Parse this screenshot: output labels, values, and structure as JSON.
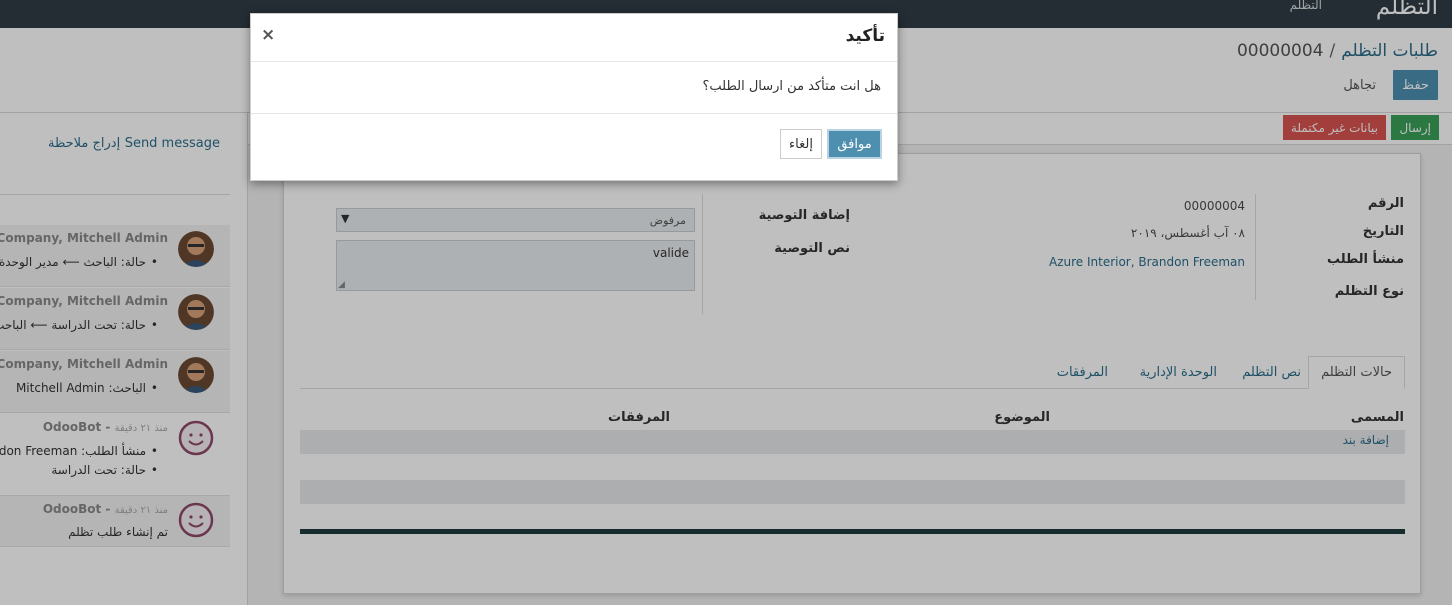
{
  "navbar": {
    "brand": "التظلم",
    "menu": "التظلم"
  },
  "breadcrumb": {
    "parent": "طلبات التظلم",
    "separator": "/",
    "current": "00000004"
  },
  "toolbar": {
    "save_label": "حفظ",
    "discard_label": "تجاهل"
  },
  "statusbar": {
    "send_label": "إرسال",
    "incomplete_label": "بيانات غير مكتملة"
  },
  "form": {
    "number_label": "الرقم",
    "number_value": "00000004",
    "date_label": "التاريخ",
    "date_value": "٠٨ آب أغسطس، ٢٠١٩",
    "origin_label": "منشأ الطلب",
    "origin_value": "Azure Interior, Brandon Freeman",
    "type_label": "نوع التظلم",
    "recommendation_label": "إضافة التوصية",
    "recommendation_value": "مرفوض",
    "recommendation_text_label": "نص التوصية",
    "recommendation_text_value": "valide"
  },
  "tabs": [
    {
      "label": "حالات التظلم",
      "active": true
    },
    {
      "label": "نص التظلم",
      "active": false
    },
    {
      "label": "الوحدة الإدارية",
      "active": false
    },
    {
      "label": "المرفقات",
      "active": false
    }
  ],
  "table": {
    "columns": [
      "المسمى",
      "الموضوع",
      "المرفقات"
    ],
    "add_line": "إضافة بند"
  },
  "chatter": {
    "send_message": "Send message",
    "log_note": "إدراج ملاحظة",
    "messages": [
      {
        "author": "YourCompany, Mitchell Admin",
        "lines": [
          "حالة: الباحث ⟵ مدير الوحدة"
        ]
      },
      {
        "author": "YourCompany, Mitchell Admin",
        "lines": [
          "حالة: تحت الدراسة ⟵ الباحث"
        ]
      },
      {
        "author": "YourCompany, Mitchell Admin",
        "lines": [
          "الباحث: Mitchell Admin"
        ]
      },
      {
        "author": "OdooBot",
        "time": "منذ ٢١ دقيقة",
        "lines": [
          "منشأ الطلب: Brandon Freeman",
          "حالة: تحت الدراسة"
        ]
      },
      {
        "author": "OdooBot",
        "time": "منذ ٢١ دقيقة",
        "text": "تم إنشاء طلب تظلم"
      }
    ]
  },
  "modal": {
    "title": "تأكيد",
    "close": "×",
    "body": "هل انت متأكد من ارسال الطلب؟",
    "ok_label": "موافق",
    "cancel_label": "إلغاء"
  },
  "colors": {
    "navbar": "#2f3d44",
    "primary": "#4e8fb0",
    "success": "#3aa05a",
    "danger": "#d9534f",
    "link": "#2b6d8a"
  }
}
